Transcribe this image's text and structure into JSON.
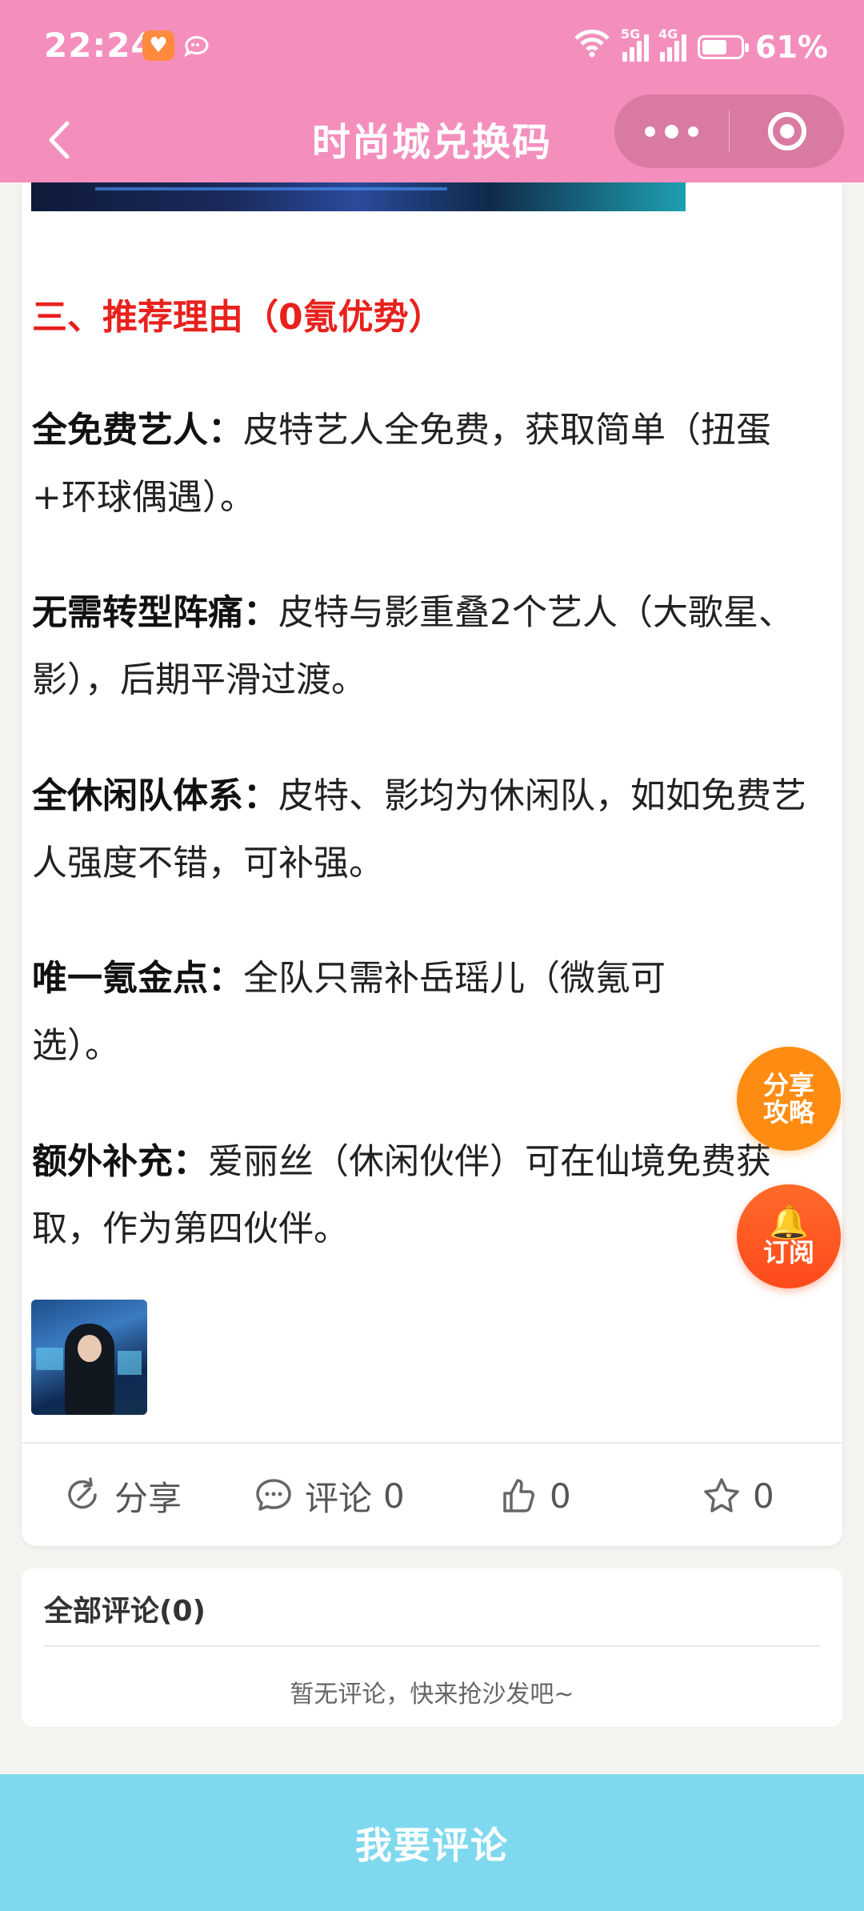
{
  "status_bar": {
    "time": "22:24",
    "network_5g": "5G",
    "network_4g": "4G",
    "battery": "61%"
  },
  "nav": {
    "title": "时尚城兑换码"
  },
  "article": {
    "section_heading": "三、推荐理由（0氪优势）",
    "paragraphs": [
      {
        "label": "全免费艺人：",
        "text": "皮特艺人全免费，获取简单（扭蛋+环球偶遇）。"
      },
      {
        "label": "无需转型阵痛：",
        "text": "皮特与影重叠2个艺人（大歌星、影），后期平滑过渡。"
      },
      {
        "label": "全休闲队体系：",
        "text": "皮特、影均为休闲队，如如免费艺人强度不错，可补强。"
      },
      {
        "label": "唯一氪金点：",
        "text": "全队只需补岳瑶儿（微氪可选）。"
      },
      {
        "label": "额外补充：",
        "text": "爱丽丝（休闲伙伴）可在仙境免费获取，作为第四伙伴。"
      }
    ]
  },
  "actions": {
    "share_label": "分享",
    "comment_label": "评论",
    "comment_count": "0",
    "like_count": "0",
    "favorite_count": "0"
  },
  "comments": {
    "title": "全部评论(0)",
    "empty_text": "暂无评论，快来抢沙发吧~"
  },
  "floating": {
    "share_line1": "分享",
    "share_line2": "攻略",
    "subscribe_label": "订阅"
  },
  "bottom": {
    "write_comment": "我要评论"
  },
  "colors": {
    "header_pink": "#f48fbd",
    "heading_red": "#e8211d",
    "bottom_button": "#7fd9ee",
    "share_fab": "#ff8c12",
    "subscribe_fab": "#ff4a1c"
  }
}
